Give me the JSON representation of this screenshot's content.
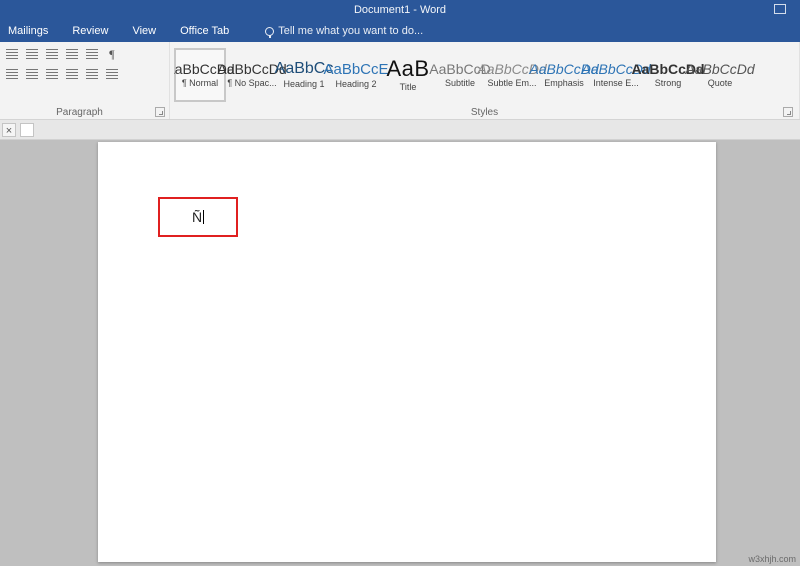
{
  "title": "Document1 - Word",
  "tabs": {
    "mailings": "Mailings",
    "review": "Review",
    "view": "View",
    "officetab": "Office Tab"
  },
  "tellme_placeholder": "Tell me what you want to do...",
  "groups": {
    "paragraph": "Paragraph",
    "styles": "Styles"
  },
  "paragraph": {
    "pilcrow": "¶"
  },
  "styles": [
    {
      "preview": "AaBbCcDd",
      "name": "¶ Normal",
      "cls": "",
      "selected": true
    },
    {
      "preview": "AaBbCcDd",
      "name": "¶ No Spac...",
      "cls": "",
      "selected": false
    },
    {
      "preview": "AaBbCc",
      "name": "Heading 1",
      "cls": "prev-heading1",
      "selected": false
    },
    {
      "preview": "AaBbCcE",
      "name": "Heading 2",
      "cls": "prev-heading2",
      "selected": false
    },
    {
      "preview": "AaB",
      "name": "Title",
      "cls": "prev-title",
      "selected": false
    },
    {
      "preview": "AaBbCcD",
      "name": "Subtitle",
      "cls": "prev-subtitle",
      "selected": false
    },
    {
      "preview": "AaBbCcDd",
      "name": "Subtle Em...",
      "cls": "prev-subtleem",
      "selected": false
    },
    {
      "preview": "AaBbCcDd",
      "name": "Emphasis",
      "cls": "prev-emphasis",
      "selected": false
    },
    {
      "preview": "AaBbCcDd",
      "name": "Intense E...",
      "cls": "prev-intense",
      "selected": false
    },
    {
      "preview": "AaBbCcDd",
      "name": "Strong",
      "cls": "prev-strong",
      "selected": false
    },
    {
      "preview": "AaBbCcDd",
      "name": "Quote",
      "cls": "prev-quote",
      "selected": false
    }
  ],
  "document": {
    "typed_char": "Ñ"
  },
  "watermark": "w3xhjh.com"
}
